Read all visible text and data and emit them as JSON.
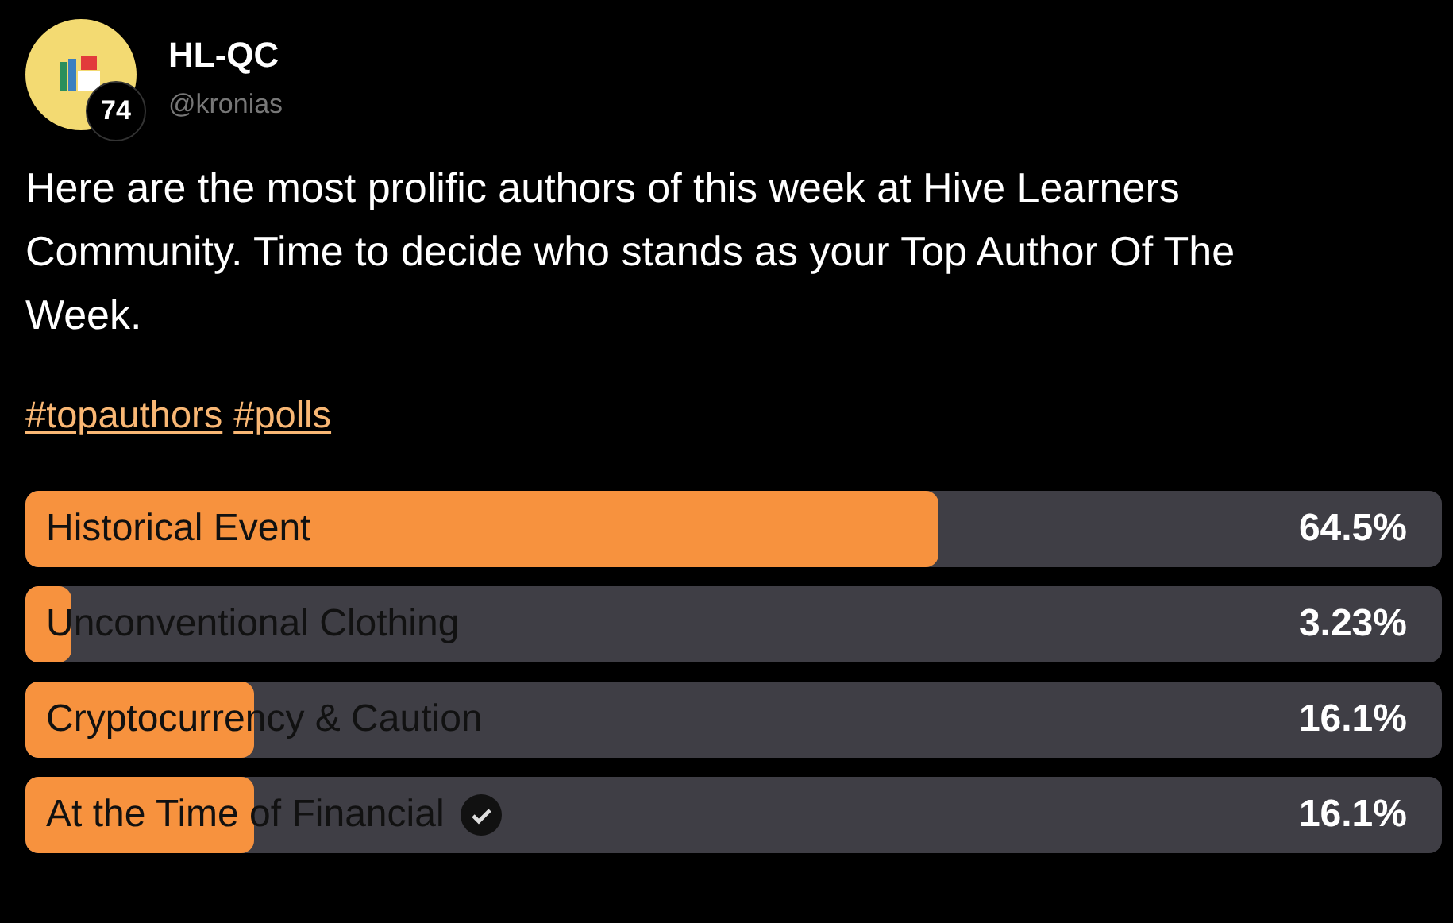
{
  "author": {
    "name": "HL-QC",
    "handle": "@kronias",
    "reputation": "74"
  },
  "post": {
    "text": "Here are the most prolific authors of this week at Hive Learners Community. Time to decide who stands as your Top Author Of The Week.",
    "tags": [
      "#topauthors",
      "#polls"
    ]
  },
  "poll": [
    {
      "label": "Historical Event",
      "percent": "64.5%",
      "level": 0.645,
      "voted": false
    },
    {
      "label": "Unconventional Clothing",
      "percent": "3.23%",
      "level": 0.0323,
      "voted": false
    },
    {
      "label": "Cryptocurrency & Caution",
      "percent": "16.1%",
      "level": 0.161,
      "voted": false
    },
    {
      "label": "At the Time of Financial",
      "percent": "16.1%",
      "level": 0.161,
      "voted": true
    }
  ]
}
